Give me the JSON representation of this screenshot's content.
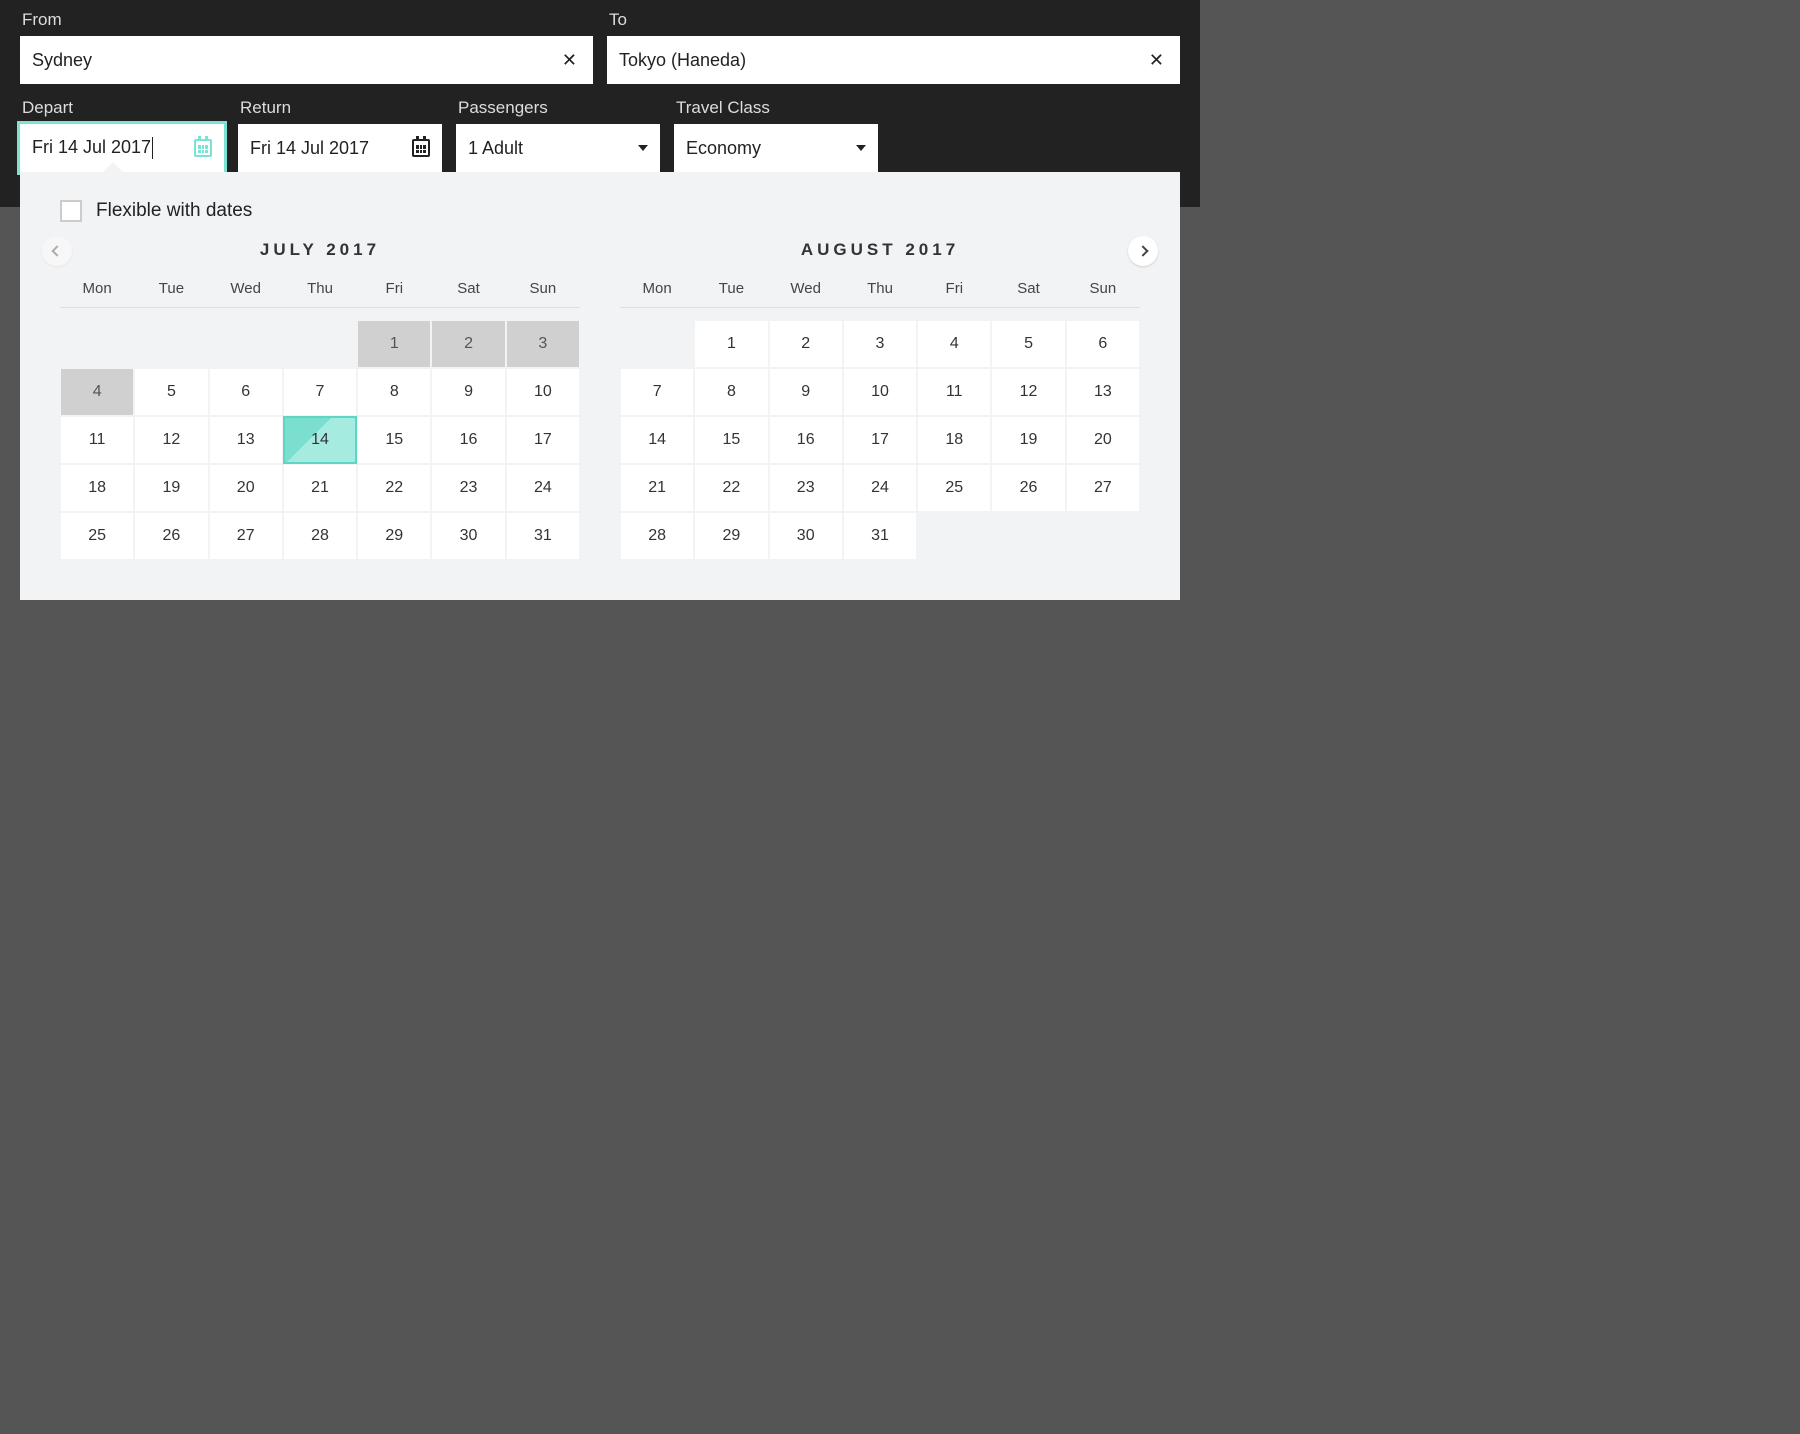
{
  "form": {
    "from": {
      "label": "From",
      "value": "Sydney"
    },
    "to": {
      "label": "To",
      "value": "Tokyo (Haneda)"
    },
    "depart": {
      "label": "Depart",
      "value": "Fri 14 Jul 2017"
    },
    "return": {
      "label": "Return",
      "value": "Fri 14 Jul 2017"
    },
    "passengers": {
      "label": "Passengers",
      "value": "1 Adult"
    },
    "class": {
      "label": "Travel Class",
      "value": "Economy"
    }
  },
  "picker": {
    "flexible_label": "Flexible with dates",
    "dow": [
      "Mon",
      "Tue",
      "Wed",
      "Thu",
      "Fri",
      "Sat",
      "Sun"
    ],
    "months": [
      {
        "title": "JULY 2017",
        "lead_blanks": 4,
        "days": 31,
        "disabled": [
          1,
          2,
          3,
          4
        ],
        "selected": 14
      },
      {
        "title": "AUGUST 2017",
        "lead_blanks": 1,
        "days": 31,
        "disabled": [],
        "selected": null
      }
    ]
  },
  "colors": {
    "accent": "#7ce2d4"
  }
}
